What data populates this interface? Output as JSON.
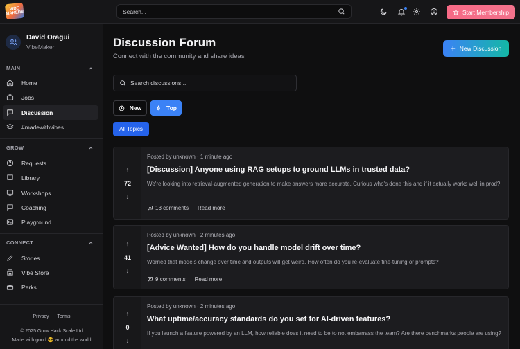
{
  "app": {
    "logo_text": "VIBE MAKERS"
  },
  "user": {
    "name": "David Oragui",
    "role": "VibeMaker"
  },
  "sidebar": {
    "sections": [
      {
        "label": "MAIN",
        "items": [
          {
            "label": "Home",
            "icon": "home-icon"
          },
          {
            "label": "Jobs",
            "icon": "briefcase-icon"
          },
          {
            "label": "Discussion",
            "icon": "message-icon",
            "active": true
          },
          {
            "label": "#madewithvibes",
            "icon": "layers-icon"
          }
        ]
      },
      {
        "label": "GROW",
        "items": [
          {
            "label": "Requests",
            "icon": "help-circle-icon"
          },
          {
            "label": "Library",
            "icon": "book-icon"
          },
          {
            "label": "Workshops",
            "icon": "presentation-icon"
          },
          {
            "label": "Coaching",
            "icon": "chat-icon"
          },
          {
            "label": "Playground",
            "icon": "terminal-icon"
          }
        ]
      },
      {
        "label": "CONNECT",
        "items": [
          {
            "label": "Stories",
            "icon": "pen-icon"
          },
          {
            "label": "Vibe Store",
            "icon": "store-icon"
          },
          {
            "label": "Perks",
            "icon": "gift-icon"
          }
        ]
      }
    ],
    "footer": {
      "privacy": "Privacy",
      "terms": "Terms",
      "copyright": "© 2025 Grow Hack Scale Ltd",
      "made_with": "Made with good 😎 around the world"
    }
  },
  "topbar": {
    "search_placeholder": "Search...",
    "membership_label": "Start Membership"
  },
  "main": {
    "title": "Discussion Forum",
    "subtitle": "Connect with the community and share ideas",
    "new_discussion_label": "New Discussion",
    "search_placeholder": "Search discussions...",
    "sort": {
      "new_label": "New",
      "top_label": "Top",
      "active": "Top"
    },
    "topic_filter": "All Topics",
    "posts": [
      {
        "meta": "Posted by unknown · 1 minute ago",
        "votes": "72",
        "title": "[Discussion] Anyone using RAG setups to ground LLMs in trusted data?",
        "excerpt": "We're looking into retrieval-augmented generation to make answers more accurate. Curious who's done this and if it actually works well in prod?",
        "comments": "13 comments",
        "read_more": "Read more"
      },
      {
        "meta": "Posted by unknown · 2 minutes ago",
        "votes": "41",
        "title": "[Advice Wanted] How do you handle model drift over time?",
        "excerpt": "Worried that models change over time and outputs will get weird. How often do you re-evaluate fine-tuning or prompts?",
        "comments": "9 comments",
        "read_more": "Read more"
      },
      {
        "meta": "Posted by unknown · 2 minutes ago",
        "votes": "0",
        "title": "What uptime/accuracy standards do you set for AI-driven features?",
        "excerpt": "If you launch a feature powered by an LLM, how reliable does it need to be to not embarrass the team? Are there benchmarks people are using?",
        "comments": "",
        "read_more": ""
      }
    ]
  },
  "colors": {
    "accent": "#3b82f6",
    "membership": "#f76a86",
    "teal": "#14b8a6"
  }
}
